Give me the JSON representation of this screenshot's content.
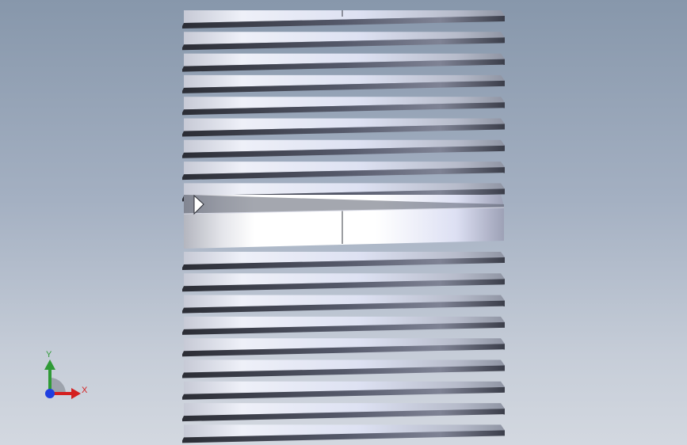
{
  "scene": {
    "part": {
      "type": "threaded nipple",
      "upper_thread_count": 9,
      "lower_thread_count": 9,
      "center_band": "unthreaded"
    }
  },
  "triad": {
    "y_label": "Y",
    "x_label": "X",
    "colors": {
      "y_axis": "#2f9a36",
      "x_axis": "#d42020",
      "z_axis": "#1f3fe0"
    }
  },
  "colors": {
    "background_top": "#8797ab",
    "background_bottom": "#d3d8e0",
    "thread_dark": "#2e3039",
    "thread_light": "#d8dcf0"
  }
}
